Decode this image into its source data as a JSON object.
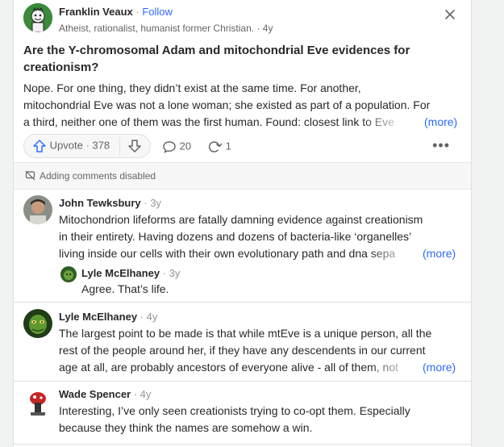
{
  "post": {
    "author": "Franklin Veaux",
    "separator": " · ",
    "follow_label": "Follow",
    "credential": "Atheist, rationalist, humanist former Christian.",
    "time": "4y",
    "question": "Are the Y-chromosomal Adam and mitochondrial Eve evidences for creationism?",
    "answer_lines": [
      "Nope. For one thing, they didn’t exist at the same time. For another,",
      "mitochondrial Eve was not a lone woman; she existed as part of a population. For",
      "a third, neither one of them was the first human. Found: closest link to Eve"
    ],
    "more_label": "(more)"
  },
  "actions": {
    "upvote_label": "Upvote",
    "upvote_count": "378",
    "comments_count": "20",
    "shares_count": "1"
  },
  "comments_notice": "Adding comments disabled",
  "comments": [
    {
      "author": "John Tewksbury",
      "time": "3y",
      "lines": [
        "Mitochondrion lifeforms are fatally damning evidence against creationism",
        "in their entirety. Having dozens and dozens of bacteria-like ‘organelles’",
        "living inside our cells with their own evolutionary path and dna sepa"
      ],
      "more_label": "(more)",
      "reply": {
        "author": "Lyle McElhaney",
        "time": "3y",
        "text": "Agree. That’s life."
      }
    },
    {
      "author": "Lyle McElhaney",
      "time": "4y",
      "lines": [
        "The largest point to be made is that while mtEve is a unique person, all the",
        "rest of the people around her, if they have any descendents in our current",
        "age at all, are probably ancestors of everyone alive - all of them, not"
      ],
      "more_label": "(more)"
    },
    {
      "author": "Wade Spencer",
      "time": "4y",
      "lines": [
        "Interesting, I’ve only seen creationists trying to co-opt them. Especially",
        "because they think the names are somehow a win."
      ]
    }
  ],
  "colors": {
    "link": "#2e69ff",
    "muted": "#636466",
    "text": "#282829",
    "upvote_icon": "#2e69ff"
  }
}
